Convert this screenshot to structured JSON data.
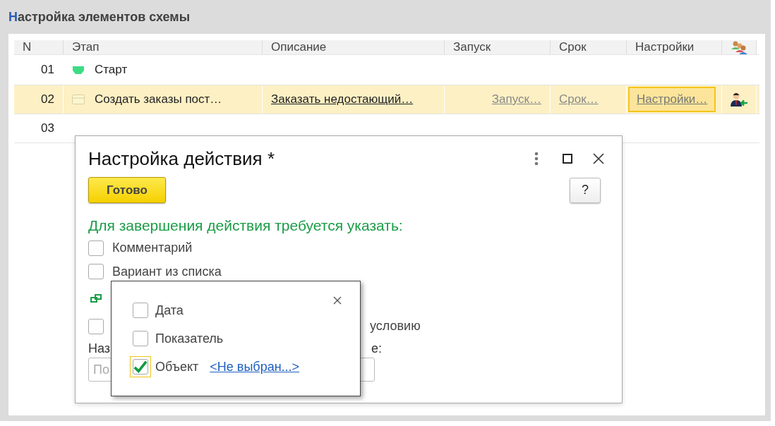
{
  "header": {
    "title": "Настройка элементов схемы"
  },
  "table": {
    "columns": [
      "N",
      "Этап",
      "Описание",
      "Запуск",
      "Срок",
      "Настройки"
    ],
    "rows": [
      {
        "n": "01",
        "kind": "start",
        "stage": "Старт",
        "selected": false
      },
      {
        "n": "02",
        "kind": "action",
        "stage": "Создать заказы пост…",
        "description": "Заказать недостающий…",
        "launch": "Запуск…",
        "deadline": "Срок…",
        "settings": "Настройки…",
        "focused": true,
        "selected": true
      },
      {
        "n": "03",
        "selected": false
      }
    ]
  },
  "dialog": {
    "title": "Настройка действия *",
    "done_button": "Готово",
    "help_button": "?",
    "prompt": "Для завершения действия требуется указать:",
    "options": [
      {
        "kind": "checkbox",
        "label": "Комментарий",
        "checked": false
      },
      {
        "kind": "checkbox",
        "label": "Вариант из списка",
        "checked": false
      },
      {
        "kind": "link"
      },
      {
        "kind": "checkbox",
        "label": "условию",
        "checked": false
      }
    ],
    "name_label_start": "Наз",
    "name_label_end": "е:",
    "name_field": {
      "placeholder": "По"
    }
  },
  "popup": {
    "items": [
      {
        "label": "Дата",
        "checked": false
      },
      {
        "label": "Показатель",
        "checked": false
      },
      {
        "label": "Объект",
        "checked": true,
        "value": "<Не выбран...>"
      }
    ]
  }
}
